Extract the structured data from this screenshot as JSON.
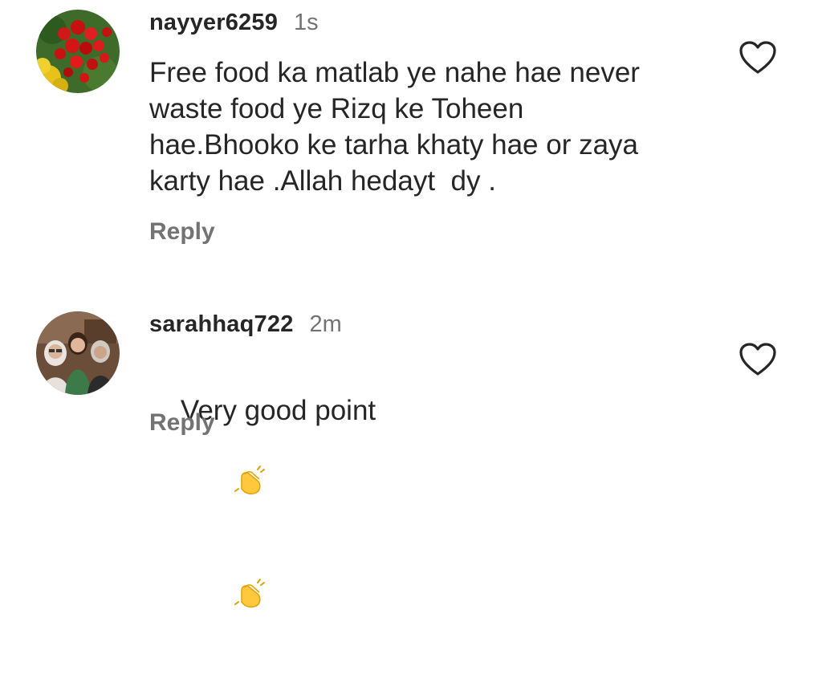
{
  "comments": [
    {
      "username": "nayyer6259",
      "time": "1s",
      "text": "Free food ka matlab ye nahe hae never\nwaste food ye Rizq ke Toheen\nhae.Bhooko ke tarha khaty hae or zaya\nkarty hae .Allah hedayt  dy .",
      "reply_label": "Reply",
      "avatar_icon": "rose-flowers-avatar",
      "like_icon": "heart-outline-icon"
    },
    {
      "username": "sarahhaq722",
      "time": "2m",
      "text": "Very good point",
      "emojis": [
        "clapping-hands-emoji",
        "clapping-hands-emoji"
      ],
      "reply_label": "Reply",
      "avatar_icon": "family-photo-avatar",
      "like_icon": "heart-outline-icon"
    }
  ],
  "colors": {
    "text_primary": "#262626",
    "text_secondary": "#737373",
    "background": "#ffffff"
  }
}
